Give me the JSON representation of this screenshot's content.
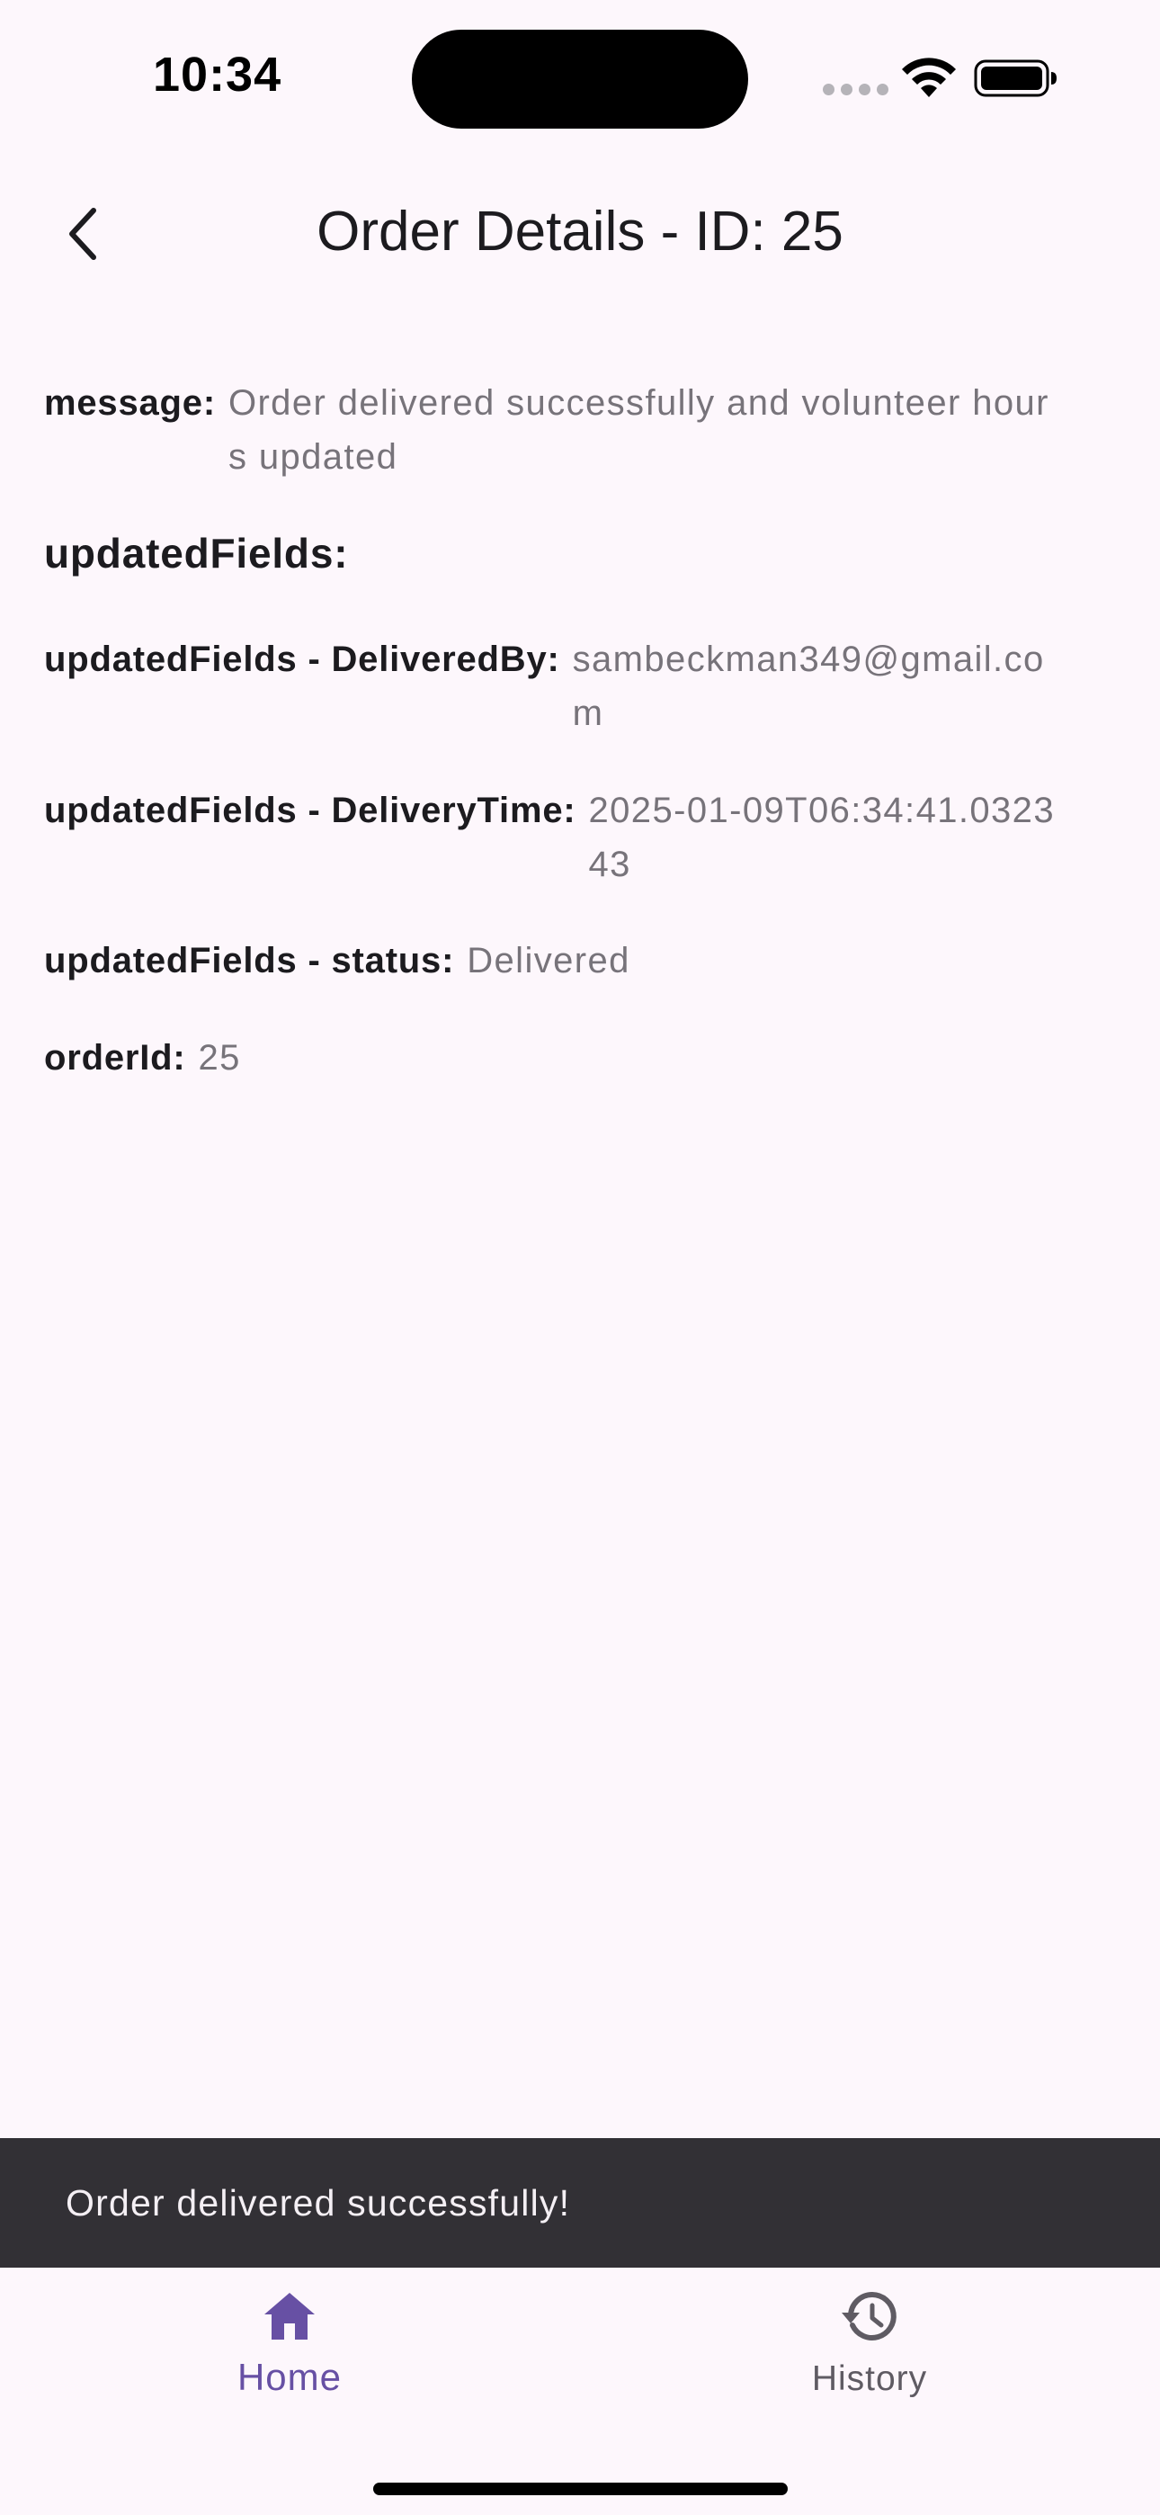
{
  "status_bar": {
    "time": "10:34"
  },
  "app_bar": {
    "title": "Order Details - ID: 25",
    "back_icon": "chevron-left-icon"
  },
  "details": {
    "message": {
      "label": "message:",
      "value": "Order delivered successfully and volunteer hours updated"
    },
    "section_heading": "updatedFields:",
    "delivered_by": {
      "label": "updatedFields - DeliveredBy:",
      "value": "sambeckman349@gmail.com"
    },
    "delivery_time": {
      "label": "updatedFields - DeliveryTime:",
      "value": "2025-01-09T06:34:41.032343"
    },
    "status": {
      "label": "updatedFields - status:",
      "value": "Delivered"
    },
    "order_id": {
      "label": "orderId:",
      "value": "25"
    }
  },
  "snackbar": {
    "text": "Order delivered successfully!"
  },
  "bottom_nav": {
    "items": [
      {
        "label": "Home",
        "icon": "home-icon",
        "selected": true
      },
      {
        "label": "History",
        "icon": "history-icon",
        "selected": false
      }
    ]
  },
  "colors": {
    "background": "#fdf7fc",
    "accent": "#6750a4",
    "snackbar": "#323035",
    "value_text": "#77737a"
  }
}
